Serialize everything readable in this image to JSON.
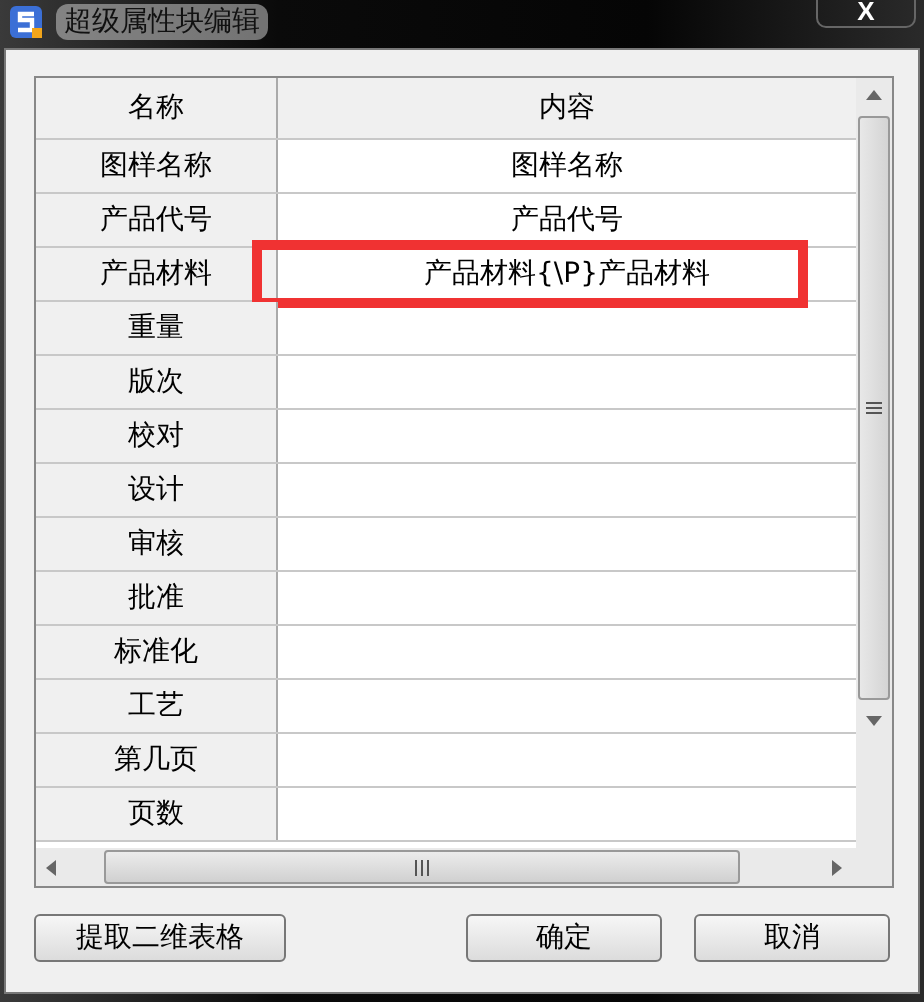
{
  "window": {
    "title": "超级属性块编辑",
    "close": "X"
  },
  "table": {
    "columns": [
      "名称",
      "内容"
    ],
    "rows": [
      {
        "name": "图样名称",
        "value": "图样名称",
        "highlighted": false
      },
      {
        "name": "产品代号",
        "value": "产品代号",
        "highlighted": false
      },
      {
        "name": "产品材料",
        "value": "产品材料{\\P}产品材料",
        "highlighted": true
      },
      {
        "name": "重量",
        "value": "",
        "highlighted": false
      },
      {
        "name": "版次",
        "value": "",
        "highlighted": false
      },
      {
        "name": "校对",
        "value": "",
        "highlighted": false
      },
      {
        "name": "设计",
        "value": "",
        "highlighted": false
      },
      {
        "name": "审核",
        "value": "",
        "highlighted": false
      },
      {
        "name": "批准",
        "value": "",
        "highlighted": false
      },
      {
        "name": "标准化",
        "value": "",
        "highlighted": false
      },
      {
        "name": "工艺",
        "value": "",
        "highlighted": false
      },
      {
        "name": "第几页",
        "value": "",
        "highlighted": false
      },
      {
        "name": "页数",
        "value": "",
        "highlighted": false
      }
    ]
  },
  "buttons": [
    {
      "label": "提取二维表格",
      "kind": "left"
    },
    {
      "label": "确定",
      "kind": "right"
    },
    {
      "label": "取消",
      "kind": "right"
    }
  ]
}
